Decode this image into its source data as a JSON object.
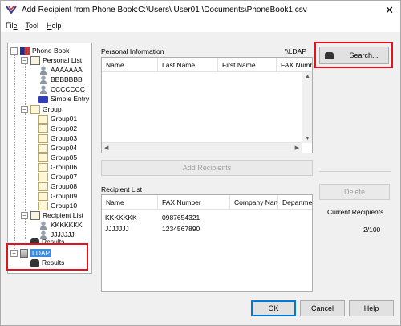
{
  "window": {
    "title": "Add Recipient from Phone Book:C:\\Users\\ User01 \\Documents\\PhoneBook1.csv"
  },
  "menu": [
    {
      "label": "File",
      "accel": "e"
    },
    {
      "label": "Tool",
      "accel": "T"
    },
    {
      "label": "Help",
      "accel": "H"
    }
  ],
  "tree": {
    "root": "Phone Book",
    "personal_list": "Personal List",
    "personal_items": [
      "AAAAAAA",
      "BBBBBBB",
      "CCCCCCC"
    ],
    "simple_entry": "Simple Entry",
    "group": "Group",
    "groups": [
      "Group01",
      "Group02",
      "Group03",
      "Group04",
      "Group05",
      "Group06",
      "Group07",
      "Group08",
      "Group09",
      "Group10"
    ],
    "recipient_list": "Recipient List",
    "recipient_items": [
      "KKKKKKK",
      "JJJJJJJ"
    ],
    "results_partial": "Results",
    "ldap": "LDAP",
    "ldap_results": "Results"
  },
  "personal_info": {
    "label": "Personal Information",
    "ldap_path": "\\\\LDAP",
    "columns": [
      "Name",
      "Last Name",
      "First Name",
      "FAX Numb"
    ]
  },
  "buttons": {
    "search": "Search...",
    "add_recipients": "Add Recipients",
    "delete": "Delete",
    "ok": "OK",
    "cancel": "Cancel",
    "help": "Help"
  },
  "recipient_list": {
    "label": "Recipient List",
    "columns": [
      "Name",
      "FAX Number",
      "Company Name",
      "Departmer"
    ],
    "rows": [
      {
        "name": "KKKKKKK",
        "fax": "0987654321"
      },
      {
        "name": "JJJJJJJ",
        "fax": "1234567890"
      }
    ]
  },
  "current_recipients": {
    "label": "Current Recipients",
    "value": "2/100"
  },
  "colors": {
    "highlight_red": "#e8111a",
    "selection_blue": "#3c8ce0"
  }
}
